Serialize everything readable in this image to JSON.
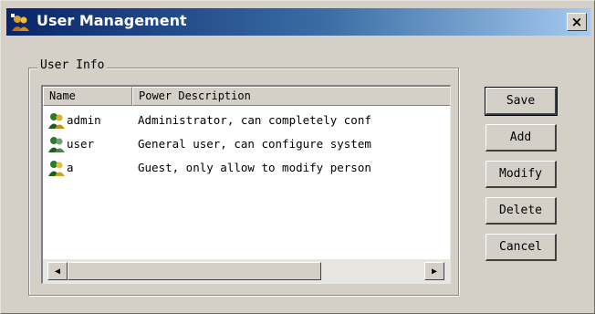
{
  "window": {
    "title": "User Management",
    "close_glyph": "×",
    "title_icon": "user-management-app-icon"
  },
  "group": {
    "label": "User Info"
  },
  "list": {
    "columns": [
      "Name",
      "Power Description"
    ],
    "rows": [
      {
        "name": "admin",
        "description": "Administrator, can completely conf",
        "icon": "admin-user-icon"
      },
      {
        "name": "user",
        "description": "General user, can configure system",
        "icon": "user-icon"
      },
      {
        "name": "a",
        "description": "Guest, only allow to modify person",
        "icon": "guest-user-icon"
      }
    ],
    "scroll_left_glyph": "◀",
    "scroll_right_glyph": "▶"
  },
  "buttons": {
    "save": "Save",
    "add": "Add",
    "modify": "Modify",
    "delete": "Delete",
    "cancel": "Cancel"
  },
  "colors": {
    "titlebar_start": "#0a246a",
    "titlebar_end": "#a6caf0",
    "dialog_bg": "#d4d0c8"
  }
}
